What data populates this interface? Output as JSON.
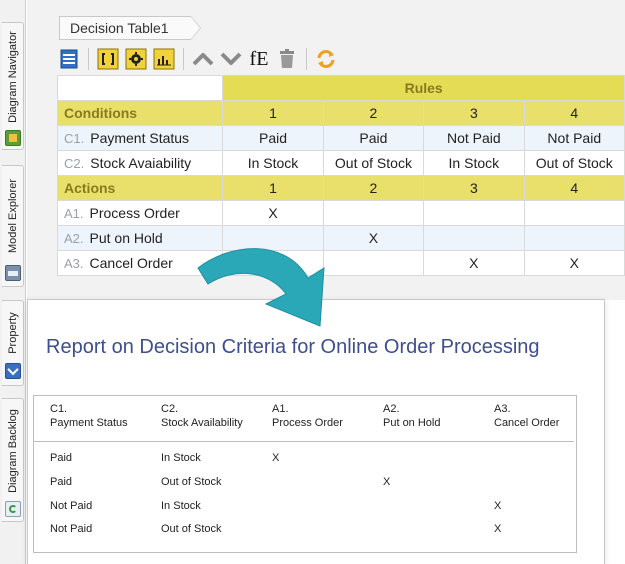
{
  "side_tabs": [
    {
      "label": "Diagram Navigator",
      "icon": "diagram-navigator-icon"
    },
    {
      "label": "Model Explorer",
      "icon": "model-explorer-icon"
    },
    {
      "label": "Property",
      "icon": "property-icon"
    },
    {
      "label": "Diagram Backlog",
      "icon": "diagram-backlog-icon"
    }
  ],
  "document_tab": "Decision Table1",
  "toolbar_icons": [
    "table-icon",
    "bracket-icon",
    "gear-icon",
    "chart-icon",
    "move-up-icon",
    "move-down-icon",
    "expression-editor-icon",
    "trash-icon",
    "refresh-icon"
  ],
  "toolbar": {
    "expression_label": "fE"
  },
  "decision_table": {
    "rules_header": "Rules",
    "conditions_header": "Conditions",
    "actions_header": "Actions",
    "rule_numbers": [
      "1",
      "2",
      "3",
      "4"
    ],
    "conditions": [
      {
        "code": "C1.",
        "name": "Payment Status",
        "values": [
          "Paid",
          "Paid",
          "Not Paid",
          "Not Paid"
        ]
      },
      {
        "code": "C2.",
        "name": "Stock Avaiability",
        "values": [
          "In Stock",
          "Out of Stock",
          "In Stock",
          "Out of Stock"
        ]
      }
    ],
    "actions": [
      {
        "code": "A1.",
        "name": "Process Order",
        "values": [
          "X",
          "",
          "",
          ""
        ]
      },
      {
        "code": "A2.",
        "name": "Put on Hold",
        "values": [
          "",
          "X",
          "",
          ""
        ]
      },
      {
        "code": "A3.",
        "name": "Cancel Order",
        "values": [
          "",
          "",
          "X",
          "X"
        ]
      }
    ]
  },
  "colors": {
    "header_yellow": "#e4dc55",
    "title_blue": "#3d4f8e",
    "arrow_teal": "#2aa8b8",
    "alt_row": "#eef4fb"
  },
  "report": {
    "title": "Report on Decision Criteria for Online Order Processing",
    "columns": [
      {
        "code": "C1.",
        "name": "Payment Status"
      },
      {
        "code": "C2.",
        "name": "Stock Availability"
      },
      {
        "code": "A1.",
        "name": "Process Order"
      },
      {
        "code": "A2.",
        "name": "Put on Hold"
      },
      {
        "code": "A3.",
        "name": "Cancel Order"
      }
    ],
    "rows": [
      [
        "Paid",
        "In Stock",
        "X",
        "",
        ""
      ],
      [
        "Paid",
        "Out of Stock",
        "",
        "X",
        ""
      ],
      [
        "Not Paid",
        "In Stock",
        "",
        "",
        "X"
      ],
      [
        "Not Paid",
        "Out of Stock",
        "",
        "",
        "X"
      ]
    ]
  }
}
